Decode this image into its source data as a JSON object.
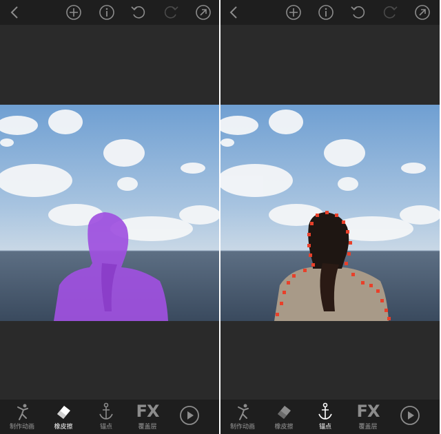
{
  "topbar": {
    "icons": [
      "back-icon",
      "add-icon",
      "info-icon",
      "undo-icon",
      "redo-icon",
      "export-icon"
    ]
  },
  "bottombar": {
    "tools": [
      {
        "icon": "animate-figure-icon",
        "label": "制作动画"
      },
      {
        "icon": "eraser-icon",
        "label": "橡皮擦"
      },
      {
        "icon": "anchor-icon",
        "label": "锚点"
      },
      {
        "icon": "fx-icon",
        "label": "覆盖层",
        "glyph": "FX"
      }
    ],
    "play_icon": "play-icon"
  },
  "panels": [
    {
      "id": "left",
      "active_tool": "橡皮擦",
      "mask_color": "#a050e0"
    },
    {
      "id": "right",
      "active_tool": "锚点",
      "anchor_color": "#e8402a"
    }
  ],
  "colors": {
    "app_bg": "#2a2a2a",
    "bar_bg": "#1e1e1e",
    "icon": "#8c8c8c",
    "label_inactive": "#9a9a9a",
    "label_active": "#ffffff"
  }
}
